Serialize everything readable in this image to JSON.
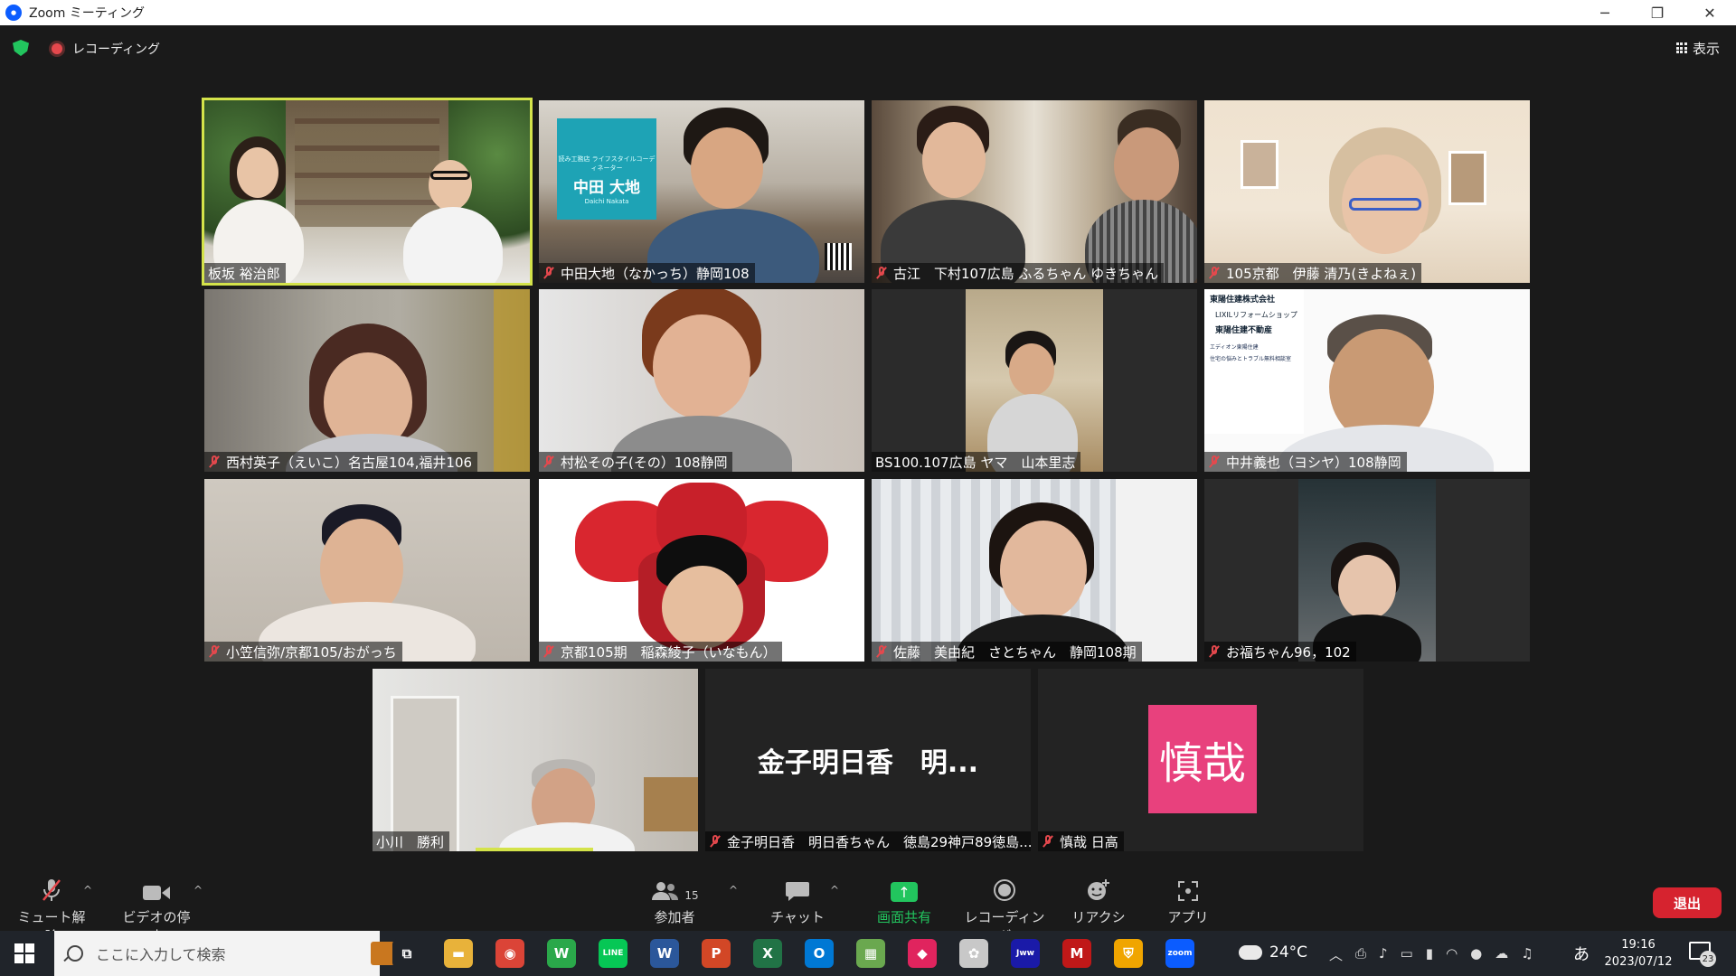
{
  "window": {
    "title": "Zoom ミーティング",
    "controls": [
      "─",
      "❐",
      "✕"
    ]
  },
  "topbar": {
    "recording_label": "レコーディング",
    "view_label": "表示"
  },
  "tiles": [
    {
      "name": "板坂 裕治郎",
      "muted": false,
      "active": true
    },
    {
      "name": "中田大地（なかっち）静岡108",
      "muted": true,
      "sign_small": "読み工務店 ライフスタイルコーディネーター",
      "sign_big": "中田 大地",
      "sign_sub": "Daichi Nakata"
    },
    {
      "name": "古江　下村107広島 ふるちゃん ゆきちゃん",
      "muted": true
    },
    {
      "name": "105京都　伊藤 清乃(きよねぇ)",
      "muted": true
    },
    {
      "name": "西村英子（えいこ）名古屋104,福井106",
      "muted": true
    },
    {
      "name": "村松その子(その）108静岡",
      "muted": true
    },
    {
      "name": "BS100.107広島 ヤマ　山本里志",
      "muted": false
    },
    {
      "name": "中井義也（ヨシヤ）108静岡",
      "muted": true,
      "bg_lines": [
        "東陽住建株式会社",
        "LIXILリフォームショップ",
        "東陽住建不動産",
        "エディオン東陽住建",
        "住宅の悩みとトラブル無料相談室"
      ]
    },
    {
      "name": "小笠信弥/京都105/おがっち",
      "muted": true
    },
    {
      "name": "京都105期　稲森綾子（いなもん）",
      "muted": true
    },
    {
      "name": "佐藤　美由紀　さとちゃん　静岡108期",
      "muted": true
    },
    {
      "name": "お福ちゃん96，102",
      "muted": true
    },
    {
      "name": "小川　勝利",
      "muted": false
    },
    {
      "name": "金子明日香　明日香ちゃん　徳島29神戸89徳島...",
      "muted": true,
      "display_name": "金子明日香　明..."
    },
    {
      "name": "慎哉 日高",
      "muted": true,
      "avatar_text": "慎哉"
    }
  ],
  "toolbar": {
    "mute_label": "ミュート解除",
    "video_label": "ビデオの停止",
    "participants_label": "参加者",
    "participants_count": "15",
    "chat_label": "チャット",
    "share_label": "画面共有",
    "record_label": "レコーディング",
    "reaction_label": "リアクション",
    "apps_label": "アプリ",
    "leave_label": "退出"
  },
  "taskbar": {
    "search_placeholder": "ここに入力して検索",
    "apps": [
      {
        "name": "task-view",
        "glyph": "⧉",
        "color": "#20242a"
      },
      {
        "name": "file-explorer",
        "glyph": "▬",
        "color": "#e8b23a"
      },
      {
        "name": "chrome",
        "glyph": "◉",
        "color": "#db4437"
      },
      {
        "name": "word-online",
        "glyph": "W",
        "color": "#2aa84a"
      },
      {
        "name": "line",
        "glyph": "LINE",
        "color": "#06c755"
      },
      {
        "name": "word",
        "glyph": "W",
        "color": "#2b579a"
      },
      {
        "name": "powerpoint",
        "glyph": "P",
        "color": "#d24726"
      },
      {
        "name": "excel",
        "glyph": "X",
        "color": "#217346"
      },
      {
        "name": "outlook",
        "glyph": "O",
        "color": "#0078d4"
      },
      {
        "name": "maps",
        "glyph": "▦",
        "color": "#6aa84f"
      },
      {
        "name": "cube-app",
        "glyph": "◆",
        "color": "#e0245e"
      },
      {
        "name": "bird-app",
        "glyph": "✿",
        "color": "#c8c8c8"
      },
      {
        "name": "jww",
        "glyph": "Jww",
        "color": "#1a1aa8"
      },
      {
        "name": "mcafee",
        "glyph": "M",
        "color": "#c01818"
      },
      {
        "name": "shield-app",
        "glyph": "⛨",
        "color": "#f0a500"
      },
      {
        "name": "zoom",
        "glyph": "zoom",
        "color": "#0b5cff"
      }
    ],
    "weather": "24°C",
    "ime": "あ",
    "time": "19:16",
    "date": "2023/07/12",
    "notification_count": "23"
  }
}
